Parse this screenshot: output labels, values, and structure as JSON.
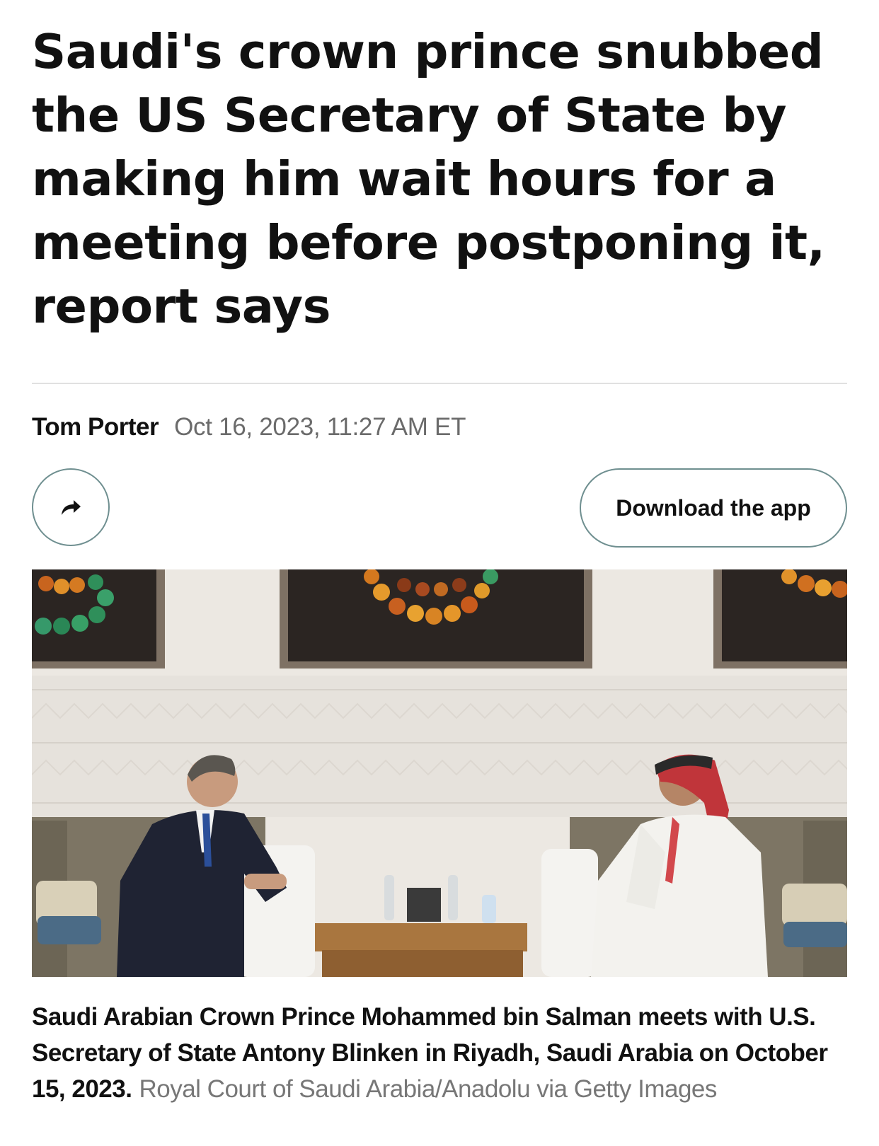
{
  "article": {
    "headline": "Saudi's crown prince snubbed the US Secretary of State by making him wait hours for a meeting before postponing it, report says",
    "author": "Tom Porter",
    "date": "Oct 16, 2023, 11:27 AM ET"
  },
  "actions": {
    "share_icon": "share-arrow-icon",
    "download_label": "Download the app"
  },
  "photo": {
    "caption": "Saudi Arabian Crown Prince Mohammed bin Salman meets with U.S. Secretary of State Antony Blinken in Riyadh, Saudi Arabia on October 15, 2023.",
    "credit": "Royal Court of Saudi Arabia/Anadolu via Getty Images"
  },
  "colors": {
    "text": "#111111",
    "muted": "#6b6b6b",
    "button_border": "#6f8f90",
    "divider": "#e1e1e1"
  }
}
